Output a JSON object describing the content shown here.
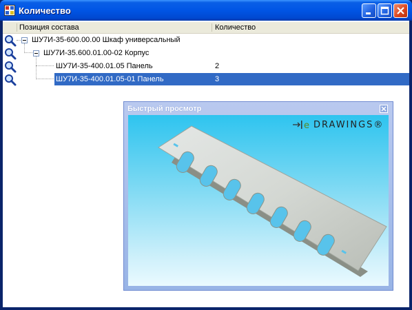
{
  "window": {
    "title": "Количество"
  },
  "columns": [
    "Позиция состава",
    "Количество"
  ],
  "rows": [
    {
      "name": "ШУ7И-35-600.00.00 Шкаф универсальный",
      "qty": ""
    },
    {
      "name": "ШУ7И-35.600.01.00-02 Корпус",
      "qty": ""
    },
    {
      "name": "ШУ7И-35-400.01.05 Панель",
      "qty": "2"
    },
    {
      "name": "ШУ7И-35-400.01.05-01 Панель",
      "qty": "3"
    }
  ],
  "quick_view": {
    "title": "Быстрый просмотр",
    "logo": "DRAWINGS®"
  },
  "colors": {
    "title_bar": "#0055e5",
    "selection": "#316ac5",
    "viewer_top": "#2ec4ef"
  }
}
